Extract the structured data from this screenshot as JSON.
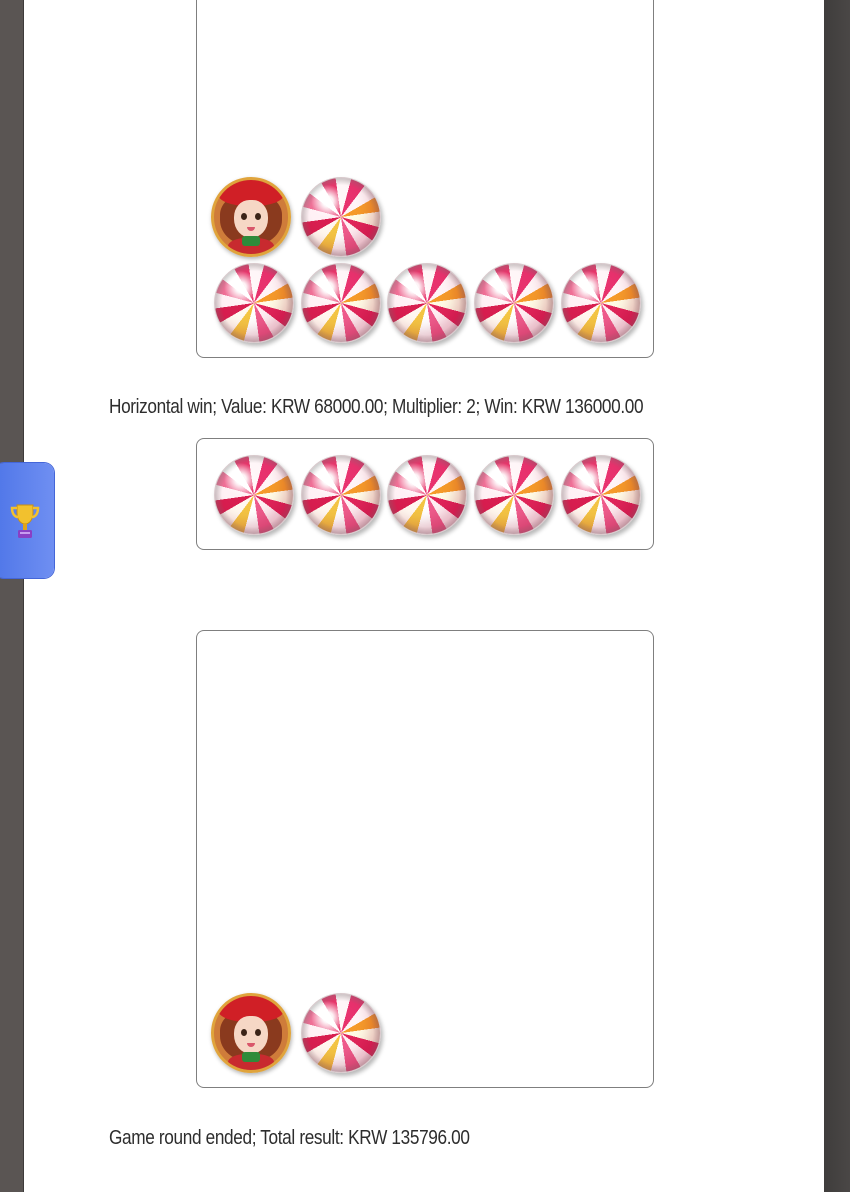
{
  "log": {
    "win_line": "Horizontal win; Value: KRW 68000.00; Multiplier: 2; Win: KRW 136000.00",
    "round_end": "Game round ended; Total result: KRW 135796.00"
  },
  "sidebar": {
    "trophy_icon": "trophy-icon",
    "accent_color": "#5b80ee"
  },
  "symbols": {
    "grid_1": [
      "girl",
      "candy",
      "candy",
      "candy",
      "candy",
      "candy",
      "candy"
    ],
    "grid_2": [
      "candy",
      "candy",
      "candy",
      "candy",
      "candy"
    ],
    "grid_3": [
      "girl",
      "candy"
    ]
  }
}
